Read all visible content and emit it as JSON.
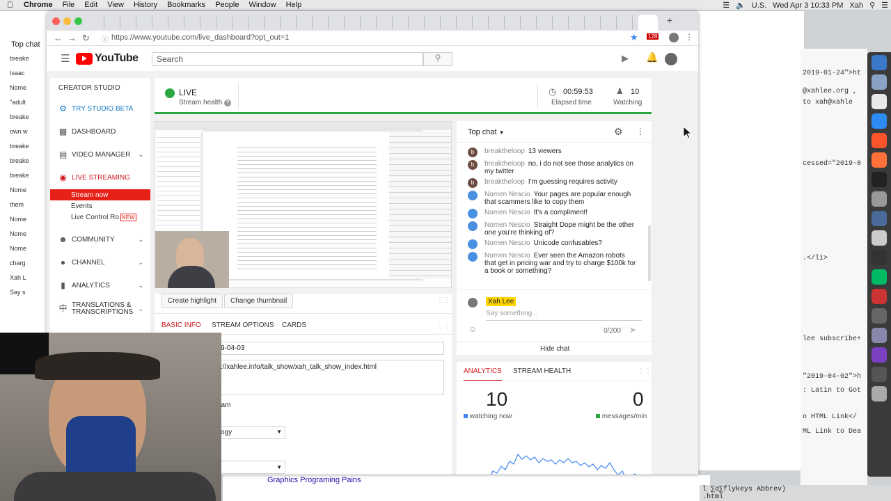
{
  "menubar": {
    "apple": "",
    "app": "Chrome",
    "items": [
      "File",
      "Edit",
      "View",
      "History",
      "Bookmarks",
      "People",
      "Window",
      "Help"
    ],
    "region": "U.S.",
    "datetime": "Wed Apr 3  10:33 PM",
    "user": "Xah"
  },
  "browser": {
    "url": "https://www.youtube.com/live_dashboard?opt_out=1",
    "badge": "128"
  },
  "youtube": {
    "logo": "YouTube",
    "search_placeholder": "Search"
  },
  "sidebar": {
    "header": "CREATOR STUDIO",
    "items": [
      {
        "label": "TRY STUDIO BETA",
        "icon": "gear-icon"
      },
      {
        "label": "DASHBOARD",
        "icon": "dashboard-icon"
      },
      {
        "label": "VIDEO MANAGER",
        "icon": "video-manager-icon"
      },
      {
        "label": "LIVE STREAMING",
        "icon": "live-icon"
      }
    ],
    "sub_items": [
      "Stream now",
      "Events",
      "Live Control Ro"
    ],
    "new_badge": "NEW",
    "bottom_items": [
      {
        "label": "COMMUNITY",
        "icon": "community-icon"
      },
      {
        "label": "CHANNEL",
        "icon": "channel-icon"
      },
      {
        "label": "ANALYTICS",
        "icon": "analytics-icon"
      },
      {
        "label": "TRANSLATIONS & TRANSCRIPTIONS",
        "icon": "translate-icon"
      }
    ]
  },
  "status": {
    "live": "LIVE",
    "stream_health": "Stream health",
    "elapsed": "00:59:53",
    "elapsed_label": "Elapsed time",
    "watching": "10",
    "watching_label": "Watching"
  },
  "video": {
    "create_highlight": "Create highlight",
    "change_thumbnail": "Change thumbnail"
  },
  "info_tabs": [
    "BASIC INFO",
    "STREAM OPTIONS",
    "CARDS"
  ],
  "info_fields": {
    "date": "9-04-03",
    "description": "://xahlee.info/talk_show/xah_talk_show_index.html",
    "label1": "eam",
    "label2": "ogy"
  },
  "chat": {
    "mode": "Top chat",
    "messages": [
      {
        "author": "breaktheloop",
        "text": "13 viewers",
        "kind": "b"
      },
      {
        "author": "breaktheloop",
        "text": "no, i do not see those analytics on my twitter",
        "kind": "b"
      },
      {
        "author": "breaktheloop",
        "text": "I'm guessing requires activity",
        "kind": "b"
      },
      {
        "author": "Nomen Nescio",
        "text": "Your pages are popular enough that scammers like to copy them",
        "kind": "n"
      },
      {
        "author": "Nomen Nescio",
        "text": "It's a compliment!",
        "kind": "n"
      },
      {
        "author": "Nomen Nescio",
        "text": "Straight Dope might be the other one you're thinking of?",
        "kind": "n"
      },
      {
        "author": "Nomen Nescio",
        "text": "Unicode confusables?",
        "kind": "n"
      },
      {
        "author": "Nomen Nescio",
        "text": "Ever seen the Amazon robots that get in pricing war and try to charge $100k for a book or something?",
        "kind": "n"
      }
    ],
    "user": "Xah Lee",
    "placeholder": "Say something...",
    "counter": "0/200",
    "hide": "Hide chat"
  },
  "analytics": {
    "tabs": [
      "ANALYTICS",
      "STREAM HEALTH"
    ],
    "watching": "10",
    "watching_label": "watching now",
    "messages": "0",
    "messages_label": "messages/min",
    "watching_color": "#4285f4",
    "messages_color": "#2ba640"
  },
  "bottom_link": "Graphics Programing Pains",
  "left_window": {
    "title": "Top chat",
    "rows": [
      "breake",
      "Isaac",
      "Nome",
      "\"adult",
      "breake",
      "own w",
      "breake",
      "breake",
      "breake",
      "Nome",
      "them",
      "Nome",
      "Nome",
      "Nome",
      "charg",
      "Xah L",
      "Say s"
    ]
  },
  "editor_lines": [
    "2019-01-24\">ht",
    "@xahlee.org ,",
    "to xah@xahle",
    "cessed=\"2019-0",
    ".</li>",
    "lee subscribe+",
    "\"2019-04-02\">h",
    ": Latin to Got",
    "o HTML Link</",
    "ML Link to Dea"
  ],
  "statusline": "l ∑α∑flykeys Abbrev)",
  "statusline2": ".html"
}
